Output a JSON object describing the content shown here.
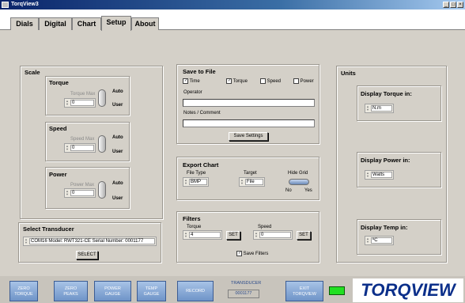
{
  "window": {
    "title": "TorqView3",
    "min": "_",
    "max": "□",
    "close": "×"
  },
  "tabs": [
    "Dials",
    "Digital",
    "Chart",
    "Setup",
    "About"
  ],
  "scale": {
    "title": "Scale",
    "torque": {
      "title": "Torque",
      "max_label": "Torque Max",
      "value": "0",
      "auto": "Auto",
      "user": "User"
    },
    "speed": {
      "title": "Speed",
      "max_label": "Speed Max",
      "value": "0",
      "auto": "Auto",
      "user": "User"
    },
    "power": {
      "title": "Power",
      "max_label": "Power Max",
      "value": "0",
      "auto": "Auto",
      "user": "User"
    }
  },
  "transducer": {
    "title": "Select Transducer",
    "value": "COM16 Model: RWT321-CE Serial Number: 0001177",
    "select": "SELECT"
  },
  "save": {
    "title": "Save to File",
    "cb_time": "Time",
    "cb_torque": "Torque",
    "cb_speed": "Speed",
    "cb_power": "Power",
    "operator": "Operator",
    "notes": "Notes / Comment",
    "button": "Save Settings"
  },
  "export": {
    "title": "Export Chart",
    "filetype_label": "File Type",
    "filetype": "BMP",
    "target_label": "Target",
    "target": "File",
    "hidegrid": "Hide Grid",
    "no": "No",
    "yes": "Yes"
  },
  "filters": {
    "title": "Filters",
    "torque_label": "Torque",
    "torque": "4",
    "speed_label": "Speed",
    "speed": "0",
    "set": "SET",
    "save": "Save Filters"
  },
  "units": {
    "title": "Units",
    "torque_title": "Display Torque in:",
    "torque": "N.m",
    "power_title": "Display Power in:",
    "power": "Watts",
    "temp_title": "Display Temp in:",
    "temp": "ºC"
  },
  "footer": {
    "zero_torque": [
      "ZERO",
      "TORQUE"
    ],
    "zero_peaks": [
      "ZERO",
      "PEAKS"
    ],
    "power_gauge": [
      "POWER",
      "GAUGE"
    ],
    "temp_gauge": [
      "TEMP",
      "GAUGE"
    ],
    "record": "RECORD",
    "transducer_label": "TRANSDUCER",
    "transducer_value": "0001177",
    "exit": [
      "EXIT",
      "TORQVIEW"
    ],
    "logo": "TORQVIEW"
  }
}
